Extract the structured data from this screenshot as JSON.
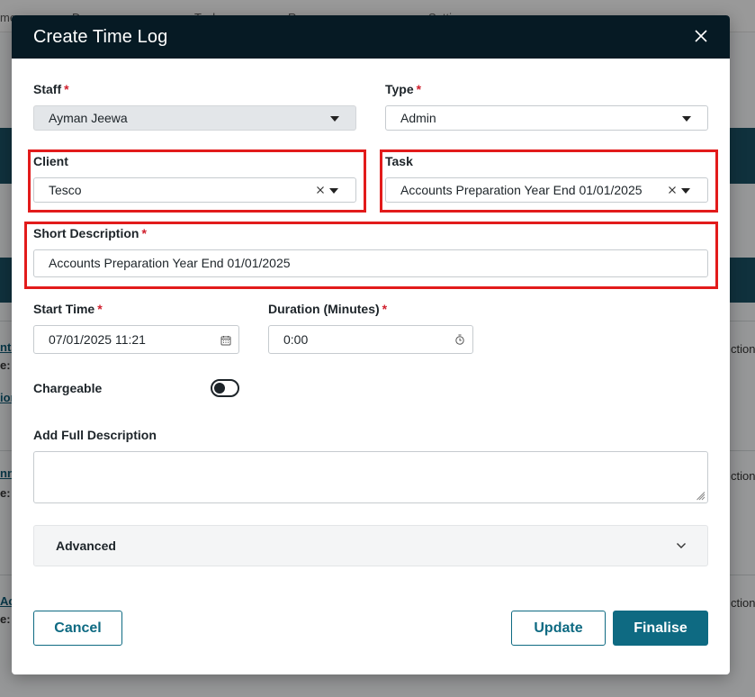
{
  "background": {
    "nav_items": [
      "me",
      "D",
      "Tasks",
      "Reco",
      "Setti"
    ],
    "side_links": [
      "nts",
      "ion",
      "nn",
      "Ac"
    ],
    "side_labels": [
      "e:",
      "e:",
      "e:"
    ],
    "right_texts": [
      "ction",
      "ction",
      "ction"
    ]
  },
  "modal": {
    "title": "Create Time Log",
    "close_icon": "close-icon"
  },
  "form": {
    "staff": {
      "label": "Staff",
      "required": "*",
      "value": "Ayman Jeewa"
    },
    "type": {
      "label": "Type",
      "required": "*",
      "value": "Admin"
    },
    "client": {
      "label": "Client",
      "value": "Tesco"
    },
    "task": {
      "label": "Task",
      "value": "Accounts Preparation Year End 01/01/2025"
    },
    "short_description": {
      "label": "Short Description",
      "required": "*",
      "value": "Accounts Preparation Year End 01/01/2025"
    },
    "start_time": {
      "label": "Start Time",
      "required": "*",
      "value": "07/01/2025 11:21"
    },
    "duration": {
      "label": "Duration (Minutes)",
      "required": "*",
      "value": "0:00"
    },
    "chargeable": {
      "label": "Chargeable",
      "state": "off"
    },
    "full_description": {
      "label": "Add Full Description",
      "value": ""
    },
    "advanced": {
      "label": "Advanced"
    }
  },
  "buttons": {
    "cancel": "Cancel",
    "update": "Update",
    "finalise": "Finalise"
  },
  "colors": {
    "header": "#061a24",
    "primary": "#0e6a82",
    "required": "#d0202e",
    "highlight": "#e21b1b"
  }
}
